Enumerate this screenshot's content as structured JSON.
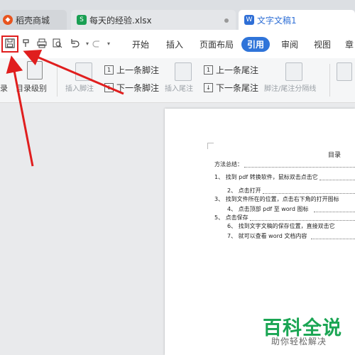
{
  "tabs": [
    {
      "label": "稻壳商城",
      "icon": "docer-icon",
      "color": "#e8541e"
    },
    {
      "label": "每天的经验.xlsx",
      "icon": "spreadsheet-icon",
      "color": "#1a9f53"
    },
    {
      "label": "文字文稿1",
      "icon": "writer-icon",
      "color": "#2f6fd6"
    }
  ],
  "menu": [
    "开始",
    "插入",
    "页面布局",
    "引用",
    "审阅",
    "视图",
    "章"
  ],
  "active_menu": "引用",
  "ribbon": {
    "toc_left": "录",
    "toc_level": "目录级别",
    "insert_footnote": "插入脚注",
    "prev_footnote": "上一条脚注",
    "next_footnote": "下一条脚注",
    "insert_endnote": "插入尾注",
    "prev_endnote": "上一条尾注",
    "next_endnote": "下一条尾注",
    "separator": "脚注/尾注分隔线"
  },
  "document": {
    "title": "目录",
    "lines": [
      "方法总结：",
      "1、 找到 pdf 转换软件，鼠标双击点击它",
      "2、 点击打开",
      "3、 找到文件所在的位置，点击右下角的打开图标",
      "4、 点击顶部 pdf 至 word 图标",
      "5、 点击保存",
      "6、 找到文字文稿的保存位置，直接双击它",
      "7、 就可以查看 word 文档内容"
    ]
  },
  "watermark": {
    "title": "百科全说",
    "subtitle": "助你轻松解决"
  },
  "colors": {
    "accent": "#2f74d9",
    "annotation": "#e01e1e",
    "watermark": "#1aa553"
  }
}
